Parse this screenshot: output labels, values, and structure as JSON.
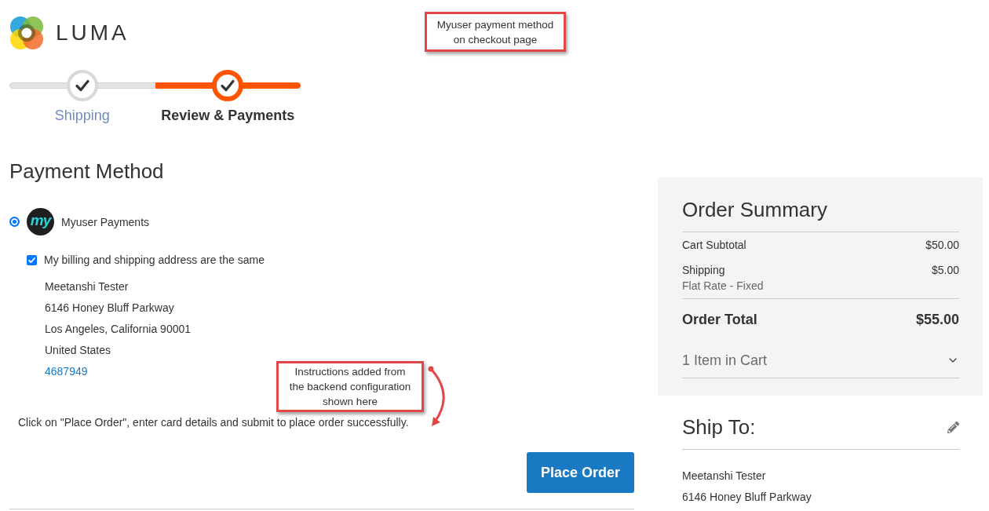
{
  "header": {
    "brand": "LUMA"
  },
  "steps": [
    {
      "label": "Shipping",
      "selected": false
    },
    {
      "label": "Review & Payments",
      "selected": true
    }
  ],
  "payment": {
    "title": "Payment Method",
    "methods": [
      {
        "logo_text": "my",
        "label": "Myuser Payments",
        "selected": true
      }
    ],
    "same_address": {
      "label": "My billing and shipping address are the same",
      "checked": true
    },
    "address_lines": [
      "Meetanshi Tester",
      "6146 Honey Bluff Parkway",
      "Los Angeles, California 90001",
      "United States"
    ],
    "phone": "4687949",
    "instructions": "Click on \"Place Order\", enter card details and submit to place order successfully.",
    "place_order_button": "Place Order"
  },
  "order_summary": {
    "title": "Order Summary",
    "rows": [
      {
        "label": "Cart Subtotal",
        "value": "$50.00"
      },
      {
        "label": "Shipping",
        "value": "$5.00",
        "note": "Flat Rate - Fixed"
      }
    ],
    "total": {
      "label": "Order Total",
      "value": "$55.00"
    },
    "items": {
      "label": "1 Item in Cart",
      "expanded": false
    }
  },
  "ship_to": {
    "title": "Ship To:",
    "address_lines": [
      "Meetanshi Tester",
      "6146 Honey Bluff Parkway"
    ]
  },
  "annotations": [
    {
      "kind": "box",
      "text": "Myuser payment method on checkout page"
    },
    {
      "kind": "arrow",
      "text": "Instructions added from the backend configuration shown here"
    }
  ]
}
